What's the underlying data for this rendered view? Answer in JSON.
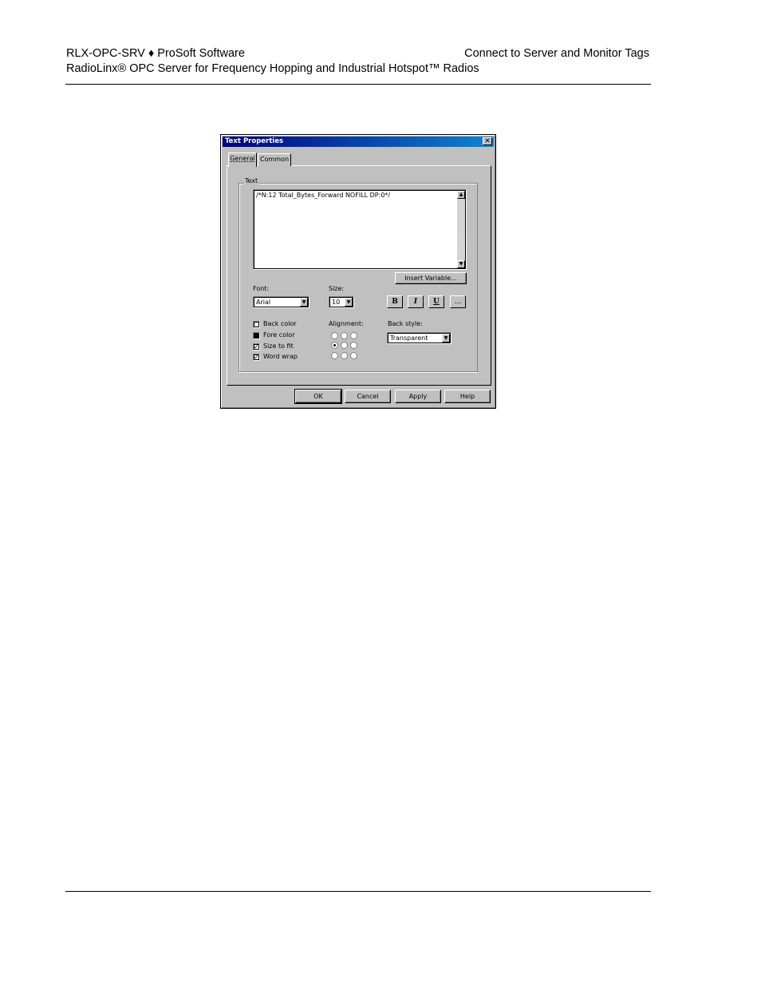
{
  "header": {
    "left_line1": "RLX-OPC-SRV ♦ ProSoft Software",
    "left_line2": "RadioLinx® OPC Server for Frequency Hopping and Industrial Hotspot™ Radios",
    "right_line1": "Connect to Server and Monitor Tags"
  },
  "dialog": {
    "title": "Text Properties",
    "close_glyph": "✕",
    "tabs": [
      "General",
      "Common"
    ],
    "active_tab": "General",
    "text_group_label": "Text",
    "text_value": "/*N:12 Total_Bytes_Forward NOFILL DP:0*/",
    "insert_variable_label": "Insert Variable...",
    "font_label": "Font:",
    "font_value": "Arial",
    "size_label": "Size:",
    "size_value": "10",
    "format_buttons": {
      "bold": "B",
      "italic": "I",
      "underline": "U",
      "more": "..."
    },
    "checkboxes": [
      {
        "label": "Back color",
        "state": "unchecked"
      },
      {
        "label": "Fore color",
        "state": "filled"
      },
      {
        "label": "Size to fit",
        "state": "checked"
      },
      {
        "label": "Word wrap",
        "state": "checked"
      }
    ],
    "alignment_label": "Alignment:",
    "alignment_selected": "middle-left",
    "back_style_label": "Back style:",
    "back_style_value": "Transparent",
    "buttons": {
      "ok": "OK",
      "cancel": "Cancel",
      "apply": "Apply",
      "help": "Help"
    },
    "arrow_glyph": "▼",
    "scroll_up_glyph": "▲",
    "check_glyph": "✓"
  }
}
